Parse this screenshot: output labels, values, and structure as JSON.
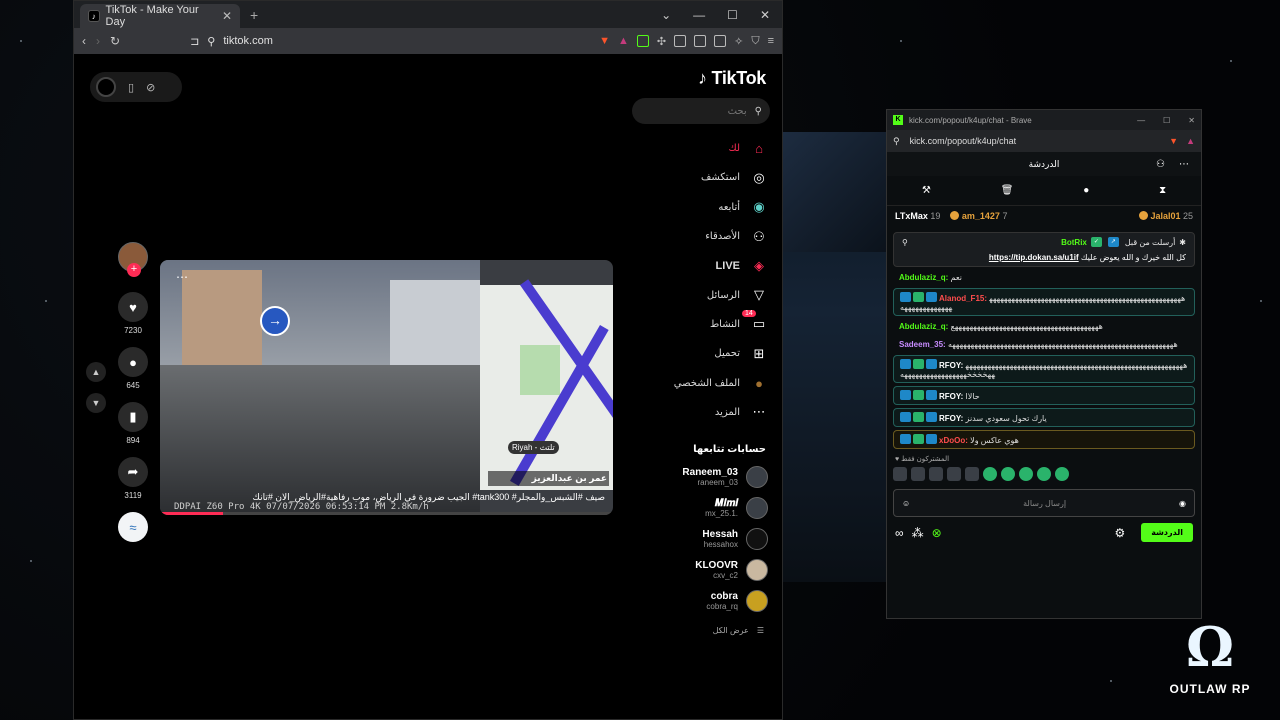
{
  "tiktok_window": {
    "tab_title": "TikTok - Make Your Day",
    "url": "tiktok.com",
    "logo": "TikTok",
    "search_placeholder": "بحث",
    "nav": [
      {
        "label": "لك",
        "icon": "home-icon"
      },
      {
        "label": "استكشف",
        "icon": "compass-icon"
      },
      {
        "label": "أتابعه",
        "icon": "following-icon"
      },
      {
        "label": "الأصدقاء",
        "icon": "friends-icon"
      },
      {
        "label": "LIVE",
        "icon": "live-icon"
      },
      {
        "label": "الرسائل",
        "icon": "send-icon"
      },
      {
        "label": "النشاط",
        "icon": "inbox-icon",
        "badge": "14"
      },
      {
        "label": "تحميل",
        "icon": "upload-icon"
      },
      {
        "label": "الملف الشخصي",
        "icon": "profile-icon"
      },
      {
        "label": "المزيد",
        "icon": "more-icon"
      }
    ],
    "following_title": "حسابات تتابعها",
    "accounts": [
      {
        "name": "Raneem_03",
        "handle": "raneem_03"
      },
      {
        "name": "𝑴𝒊𝒎𝒊",
        "handle": "mx_25.1."
      },
      {
        "name": "Hessah",
        "handle": "hessahox"
      },
      {
        "name": "KLOOVR",
        "handle": "cxv_c2"
      },
      {
        "name": "cobra",
        "handle": "cobra_rq"
      }
    ],
    "see_all": "عرض الكل",
    "video": {
      "caption": "الجيب ضرورة في الرياض، موب رفاهية#الرياض_الان #تانك #tank300 #صيف #الشبس_والمجلر",
      "dashcam": "DDPAI Z60 Pro 4K",
      "timestamp": "07/07/2026 06:53:14 PM  2.8Km/h",
      "map_street": "عمر بن عبدالعزيز",
      "map_city": "Riyah - تلتث"
    },
    "actions": [
      {
        "icon": "heart-icon",
        "count": "7230"
      },
      {
        "icon": "comment-icon",
        "count": "645"
      },
      {
        "icon": "bookmark-icon",
        "count": "894"
      },
      {
        "icon": "share-icon",
        "count": "3119"
      }
    ]
  },
  "kick_window": {
    "title": "kick.com/popout/k4up/chat - Brave",
    "url": "kick.com/popout/k4up/chat",
    "chat_title": "الدردشة",
    "leaders": [
      {
        "name": "LTxMax",
        "count": "19"
      },
      {
        "name": "am_1427",
        "count": "7"
      },
      {
        "name": "Jalal01",
        "count": "25"
      }
    ],
    "pinned": {
      "header": "أرسلت من قبل",
      "user": "BotRix",
      "message": "كل الله خيرك و الله يعوض عليك",
      "link": "https://tip.dokan.sa/u1if"
    },
    "messages": [
      {
        "user": "Abdulaziz_q:",
        "text": "نعم",
        "color": "#53fc18",
        "style": "plain"
      },
      {
        "user": "Alanod_F15:",
        "text": "ههههههههههههههههههههههههههههههههههههههههههههههههههههههههههههههههههه",
        "color": "#ff4d4d",
        "style": "box"
      },
      {
        "user": "Abdulaziz_q:",
        "text": "ههههههههههههههههههههههههههههههههههههههههع",
        "color": "#53fc18",
        "style": "plain"
      },
      {
        "user": "Sadeem_35:",
        "text": "هههههههههههههههههههههههههههههههههههههههههههههههههههههههههههههه",
        "color": "#c88cff",
        "style": "plain"
      },
      {
        "user": "RFOY:",
        "text": "ههههههههههههههههههههههههههههههههههههههههههههههههههههههههههههههخخخخهههههههههههههههههه",
        "color": "#ffffff",
        "style": "box"
      },
      {
        "user": "RFOY:",
        "text": "حالاا",
        "color": "#ffffff",
        "style": "box"
      },
      {
        "user": "RFOY:",
        "text": "يارك تحول سعودي سدنز",
        "color": "#ffffff",
        "style": "box"
      },
      {
        "user": "xDoOo:",
        "text": "هوي عاكس ولا",
        "color": "#ff4d4d",
        "style": "gold"
      }
    ],
    "subs_label": "المشتركون فقط",
    "input_placeholder": "إرسال رسالة",
    "chat_button": "الدردشة"
  },
  "watermark": "OUTLAW RP"
}
